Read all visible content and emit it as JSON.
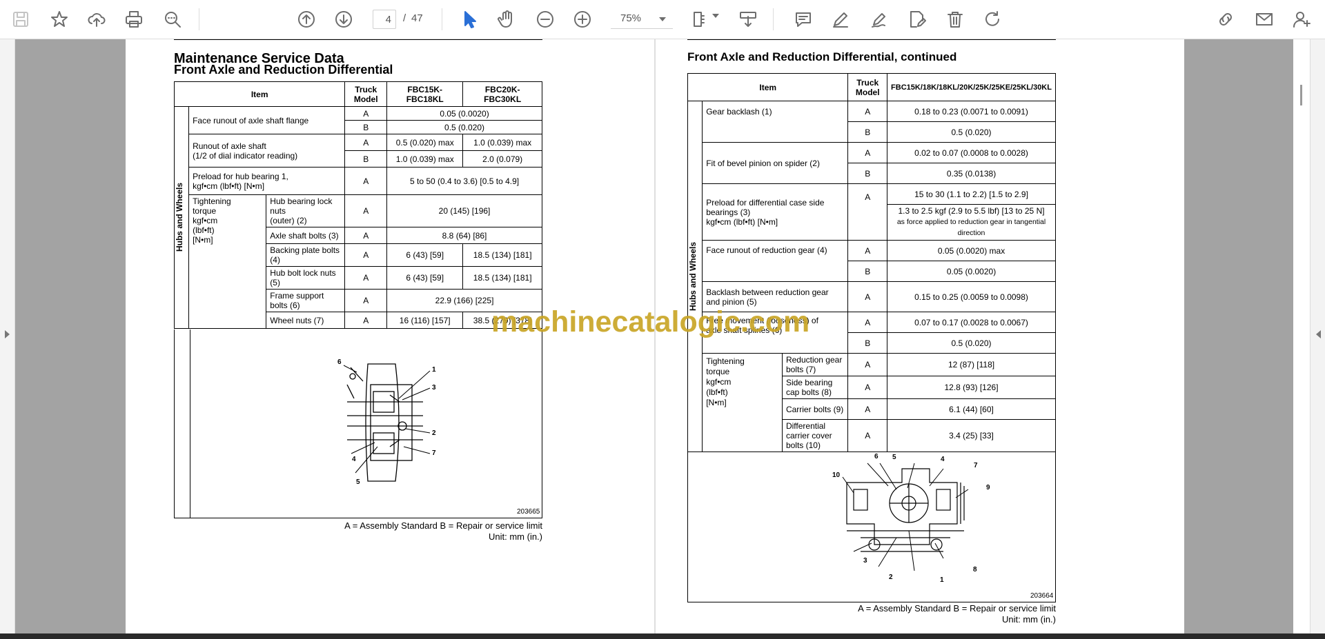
{
  "toolbar": {
    "page_current": "4",
    "page_sep": "/",
    "page_total": "47",
    "zoom": "75%",
    "icons": [
      "save-icon",
      "bookmark-star-icon",
      "upload-icon",
      "print-icon",
      "search-zoom-icon",
      "page-up-icon",
      "page-down-icon",
      "zoom-out-icon",
      "zoom-in-icon",
      "select-cursor-icon",
      "hand-icon",
      "page-layout-icon",
      "download-icon",
      "comment-icon",
      "pen-icon",
      "sign-icon",
      "edit-pdf-icon",
      "delete-icon",
      "rotate-icon",
      "share-link-icon",
      "email-icon",
      "add-user-icon"
    ]
  },
  "left": {
    "section_title": "Maintenance Service Data",
    "subtitle": "Front Axle and Reduction Differential",
    "table_header": {
      "item": "Item",
      "truck_model": "Truck Model",
      "col1": "FBC15K-\nFBC18KL",
      "col2": "FBC20K-\nFBC30KL"
    },
    "side_label": "Hubs and Wheels",
    "rows": [
      {
        "item": "Face runout of axle shaft flange",
        "a": "0.05 (0.0020)",
        "b": "0.5 (0.020)"
      },
      {
        "item": "Runout of axle shaft\n(1/2 of dial indicator reading)",
        "a1": "0.5 (0.020) max",
        "a2": "1.0 (0.039) max",
        "b1": "1.0 (0.039) max",
        "b2": "2.0 (0.079)"
      },
      {
        "item": "Preload for hub bearing 1,\nkgf•cm (lbf•ft) [N•m]",
        "a": "5 to 50 (0.4 to 3.6) [0.5 to 4.9]"
      }
    ],
    "torque_label": "Tightening\ntorque\nkgf•cm\n(lbf•ft)\n[N•m]",
    "torque_rows": [
      {
        "item": "Hub bearing lock nuts\n(outer) (2)",
        "model": "A",
        "v": "20 (145) [196]"
      },
      {
        "item": "Axle shaft bolts (3)",
        "model": "A",
        "v": "8.8 (64) [86]"
      },
      {
        "item": "Backing plate bolts (4)",
        "model": "A",
        "v1": "6 (43) [59]",
        "v2": "18.5 (134) [181]"
      },
      {
        "item": "Hub bolt lock nuts (5)",
        "model": "A",
        "v1": "6 (43) [59]",
        "v2": "18.5 (134) [181]"
      },
      {
        "item": "Frame support bolts (6)",
        "model": "A",
        "v": "22.9 (166) [225]"
      },
      {
        "item": "Wheel nuts (7)",
        "model": "A",
        "v1": "16 (116) [157]",
        "v2": "38.5 (279) [378]"
      }
    ],
    "model_a": "A",
    "model_b": "B",
    "figure_id": "203665",
    "figure_labels": [
      "6",
      "1",
      "3",
      "2",
      "4",
      "7",
      "5"
    ],
    "note1": "A = Assembly Standard  B = Repair or service limit",
    "note2": "Unit: mm (in.)"
  },
  "right": {
    "subtitle": "Front Axle and Reduction Differential, continued",
    "table_header": {
      "item": "Item",
      "truck_model": "Truck Model",
      "col": "FBC15K/18K/18KL/20K/25K/25KE/25KL/30KL"
    },
    "side_label": "Hubs and Wheels",
    "rows": [
      {
        "item": "Gear backlash (1)",
        "a": "0.18 to 0.23 (0.0071 to 0.0091)",
        "b": "0.5 (0.020)"
      },
      {
        "item": "Fit of bevel pinion on spider (2)",
        "a": "0.02 to 0.07 (0.0008 to 0.0028)",
        "b": "0.35 (0.0138)"
      },
      {
        "item": "Preload for differential case side bearings (3)\nkgf•cm (lbf•ft) [N•m]",
        "a1": "15 to 30 (1.1 to 2.2) [1.5 to 2.9]",
        "a2": "1.3 to 2.5 kgf (2.9 to 5.5 lbf) [13 to 25 N]",
        "a3": "as force applied to reduction gear in tangential direction"
      },
      {
        "item": "Face runout of reduction gear (4)",
        "a": "0.05 (0.0020) max",
        "b": "0.05 (0.0020)"
      },
      {
        "item": "Backlash between reduction gear\nand pinion (5)",
        "a": "0.15 to 0.25 (0.0059 to 0.0098)"
      },
      {
        "item": "Free movement (looseness) of\naxle shaft splines (6)",
        "a": "0.07 to 0.17 (0.0028 to 0.0067)",
        "b": "0.5 (0.020)"
      }
    ],
    "torque_label": "Tightening\ntorque\nkgf•cm\n(lbf•ft)\n[N•m]",
    "torque_rows": [
      {
        "item": "Reduction gear bolts (7)",
        "model": "A",
        "v": "12 (87) [118]"
      },
      {
        "item": "Side bearing cap bolts (8)",
        "model": "A",
        "v": "12.8 (93) [126]"
      },
      {
        "item": "Carrier bolts (9)",
        "model": "A",
        "v": "6.1 (44) [60]"
      },
      {
        "item": "Differential carrier cover\nbolts (10)",
        "model": "A",
        "v": "3.4 (25) [33]"
      }
    ],
    "model_a": "A",
    "model_b": "B",
    "figure_id": "203664",
    "figure_labels": [
      "6",
      "5",
      "4",
      "7",
      "10",
      "9",
      "3",
      "2",
      "1",
      "8"
    ],
    "note1": "A = Assembly Standard  B = Repair or service limit",
    "note2": "Unit: mm (in.)"
  },
  "watermark": "machinecatalogic.com"
}
